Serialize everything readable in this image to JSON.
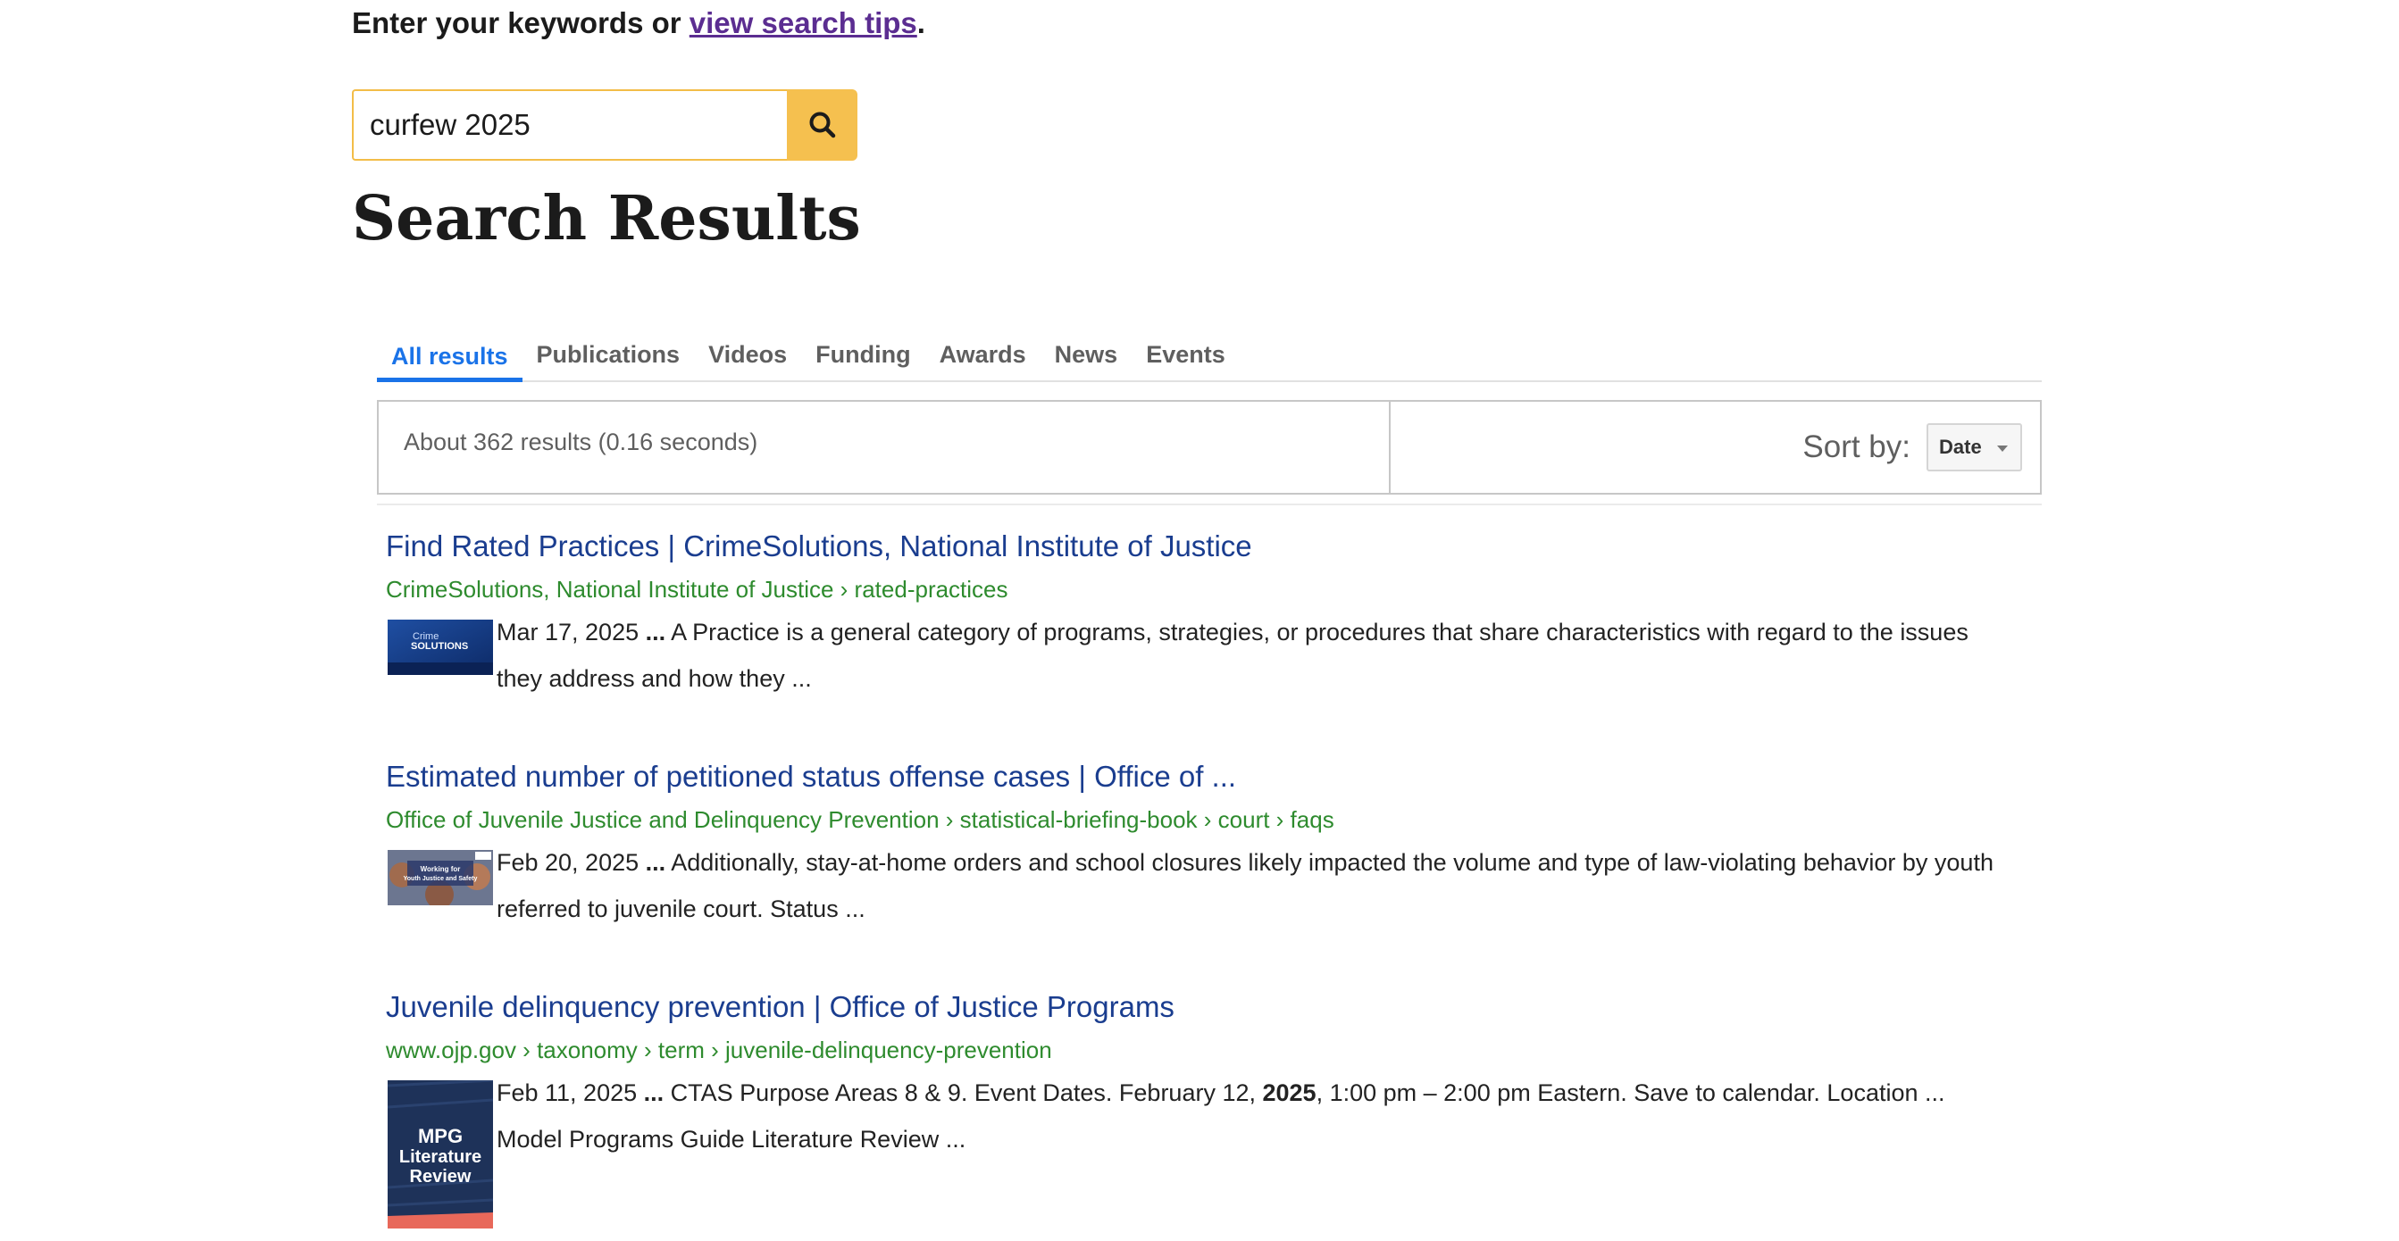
{
  "intro": {
    "prefix": "Enter your keywords or ",
    "link": "view search tips",
    "suffix": "."
  },
  "search": {
    "value": "curfew 2025",
    "button_icon": "search-icon"
  },
  "title": "Search Results",
  "tabs": [
    {
      "label": "All results",
      "active": true
    },
    {
      "label": "Publications",
      "active": false
    },
    {
      "label": "Videos",
      "active": false
    },
    {
      "label": "Funding",
      "active": false
    },
    {
      "label": "Awards",
      "active": false
    },
    {
      "label": "News",
      "active": false
    },
    {
      "label": "Events",
      "active": false
    }
  ],
  "results_info": "About 362 results (0.16 seconds)",
  "sort": {
    "label": "Sort by:",
    "selected": "Date"
  },
  "results": [
    {
      "title": "Find Rated Practices | CrimeSolutions, National Institute of Justice",
      "url": "CrimeSolutions, National Institute of Justice › rated-practices",
      "date": "Mar 17, 2025",
      "ellipsis": "...",
      "snippet": "A Practice is a general category of programs, strategies, or procedures that share characteristics with regard to the issues they address and how they ...",
      "thumb": {
        "icon": "crimesolutions-thumbnail",
        "line1": "Crime",
        "line2": "SOLUTIONS"
      }
    },
    {
      "title": "Estimated number of petitioned status offense cases | Office of ...",
      "url": "Office of Juvenile Justice and Delinquency Prevention › statistical-briefing-book › court › faqs",
      "date": "Feb 20, 2025",
      "ellipsis": "...",
      "snippet": "Additionally, stay-at-home orders and school closures likely impacted the volume and type of law-violating behavior by youth referred to juvenile court. Status ...",
      "thumb": {
        "icon": "ojjdp-thumbnail",
        "line1": "Working for",
        "line2": "Youth Justice and Safety"
      }
    },
    {
      "title": "Juvenile delinquency prevention | Office of Justice Programs",
      "url": "www.ojp.gov › taxonomy › term › juvenile-delinquency-prevention",
      "date": "Feb 11, 2025",
      "ellipsis": "...",
      "snippet_before": "CTAS Purpose Areas 8 & 9. Event Dates. February 12, ",
      "snippet_bold": "2025",
      "snippet_after": ", 1:00 pm – 2:00 pm Eastern. Save to calendar. Location ... Model Programs Guide Literature Review ...",
      "thumb": {
        "icon": "mpg-literature-review-thumbnail",
        "line1": "MPG",
        "line2": "Literature",
        "line3": "Review"
      }
    }
  ],
  "colors": {
    "accent": "#1a73e8",
    "search_button": "#f5c04f",
    "link_title": "#1a3d8f",
    "url_green": "#2e8b2e",
    "visited_link": "#5b2d91"
  }
}
